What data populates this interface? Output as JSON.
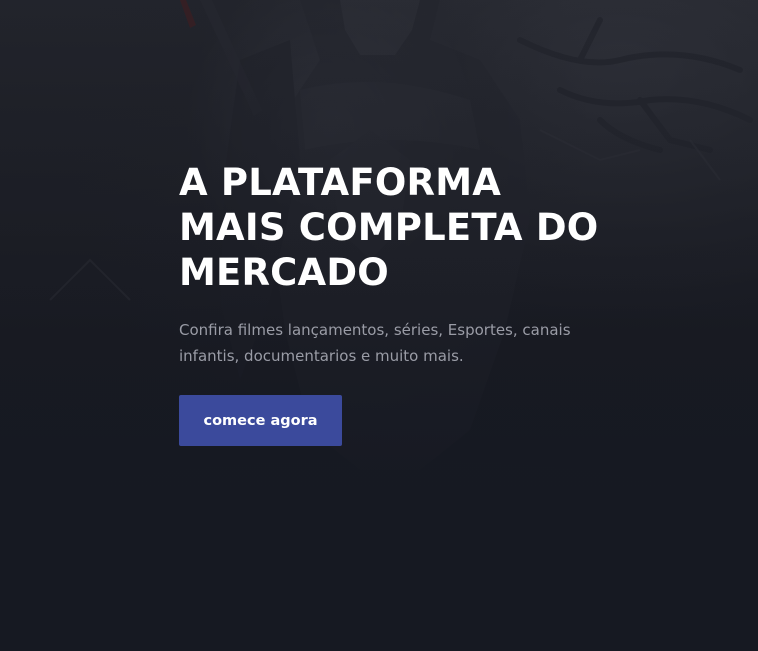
{
  "hero": {
    "title_lines": [
      "A PLATAFORMA",
      "MAIS COMPLETA DO",
      "MERCADO"
    ],
    "subtitle": "Confira filmes lançamentos, séries, Esportes, canais infantis, documentarios e muito mais.",
    "cta_label": "comece agora"
  },
  "colors": {
    "background": "#161922",
    "title": "#ffffff",
    "subtitle": "#9a9ca6",
    "button": "#3b4a9c",
    "button_text": "#ffffff"
  },
  "background_image": {
    "subject": "dark armored warrior figure with tree branches"
  }
}
